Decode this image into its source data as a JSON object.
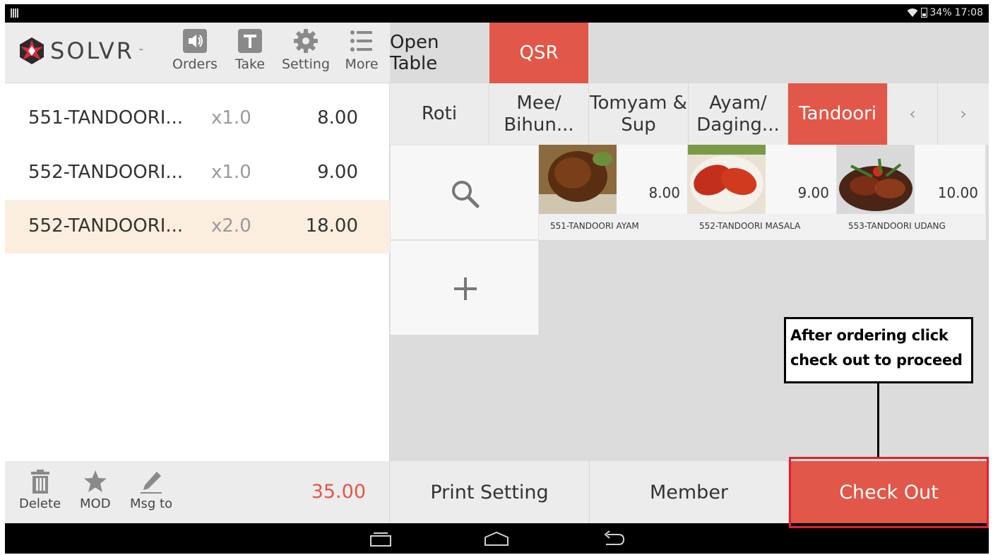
{
  "status_bar": {
    "battery": "34%",
    "time": "17:08"
  },
  "brand": {
    "name": "SOLVR",
    "tm": "™"
  },
  "toolbar": [
    {
      "label": "Orders",
      "icon": "speaker-icon"
    },
    {
      "label": "Take",
      "icon": "take-t-icon"
    },
    {
      "label": "Setting",
      "icon": "gear-icon"
    },
    {
      "label": "More",
      "icon": "list-icon"
    }
  ],
  "header": {
    "open_table": "Open Table",
    "qsr": "QSR"
  },
  "order_items": [
    {
      "name": "551-TANDOORI...",
      "qty": "x1.0",
      "amount": "8.00",
      "selected": false
    },
    {
      "name": "552-TANDOORI...",
      "qty": "x1.0",
      "amount": "9.00",
      "selected": false
    },
    {
      "name": "552-TANDOORI...",
      "qty": "x2.0",
      "amount": "18.00",
      "selected": true
    }
  ],
  "order_actions": [
    {
      "label": "Delete",
      "icon": "trash-icon"
    },
    {
      "label": "MOD",
      "icon": "star-icon"
    },
    {
      "label": "Msg to",
      "icon": "pencil-icon"
    }
  ],
  "total": "35.00",
  "categories": [
    {
      "label": "Roti",
      "active": false
    },
    {
      "label": "Mee/\nBihun...",
      "active": false
    },
    {
      "label": "Tomyam &\nSup",
      "active": false
    },
    {
      "label": "Ayam/\nDaging...",
      "active": false
    },
    {
      "label": "Tandoori",
      "active": true
    },
    {
      "label": "‹",
      "active": false
    },
    {
      "label": "›",
      "active": false
    }
  ],
  "menu_items": [
    {
      "name": "551-TANDOORI AYAM",
      "price": "8.00"
    },
    {
      "name": "552-TANDOORI MASALA",
      "price": "9.00"
    },
    {
      "name": "553-TANDOORI UDANG",
      "price": "10.00"
    }
  ],
  "bottom_actions": {
    "print_setting": "Print Setting",
    "member": "Member",
    "check_out": "Check Out"
  },
  "annotation": {
    "line1": "After ordering click",
    "line2": "check out to proceed"
  },
  "colors": {
    "accent": "#e15749",
    "selected_row": "#fbeede",
    "annotation_frame": "#e2202a"
  }
}
